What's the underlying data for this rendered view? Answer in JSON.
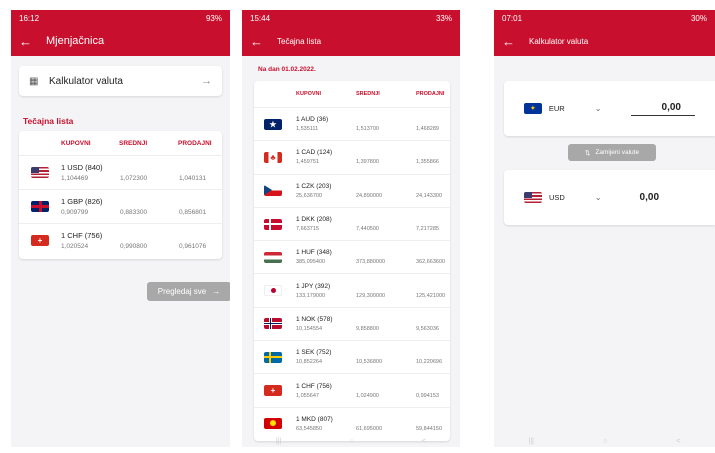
{
  "screen1": {
    "status": {
      "time": "16:12",
      "battery": "93%"
    },
    "title": "Mjenjačnica",
    "converter_label": "Kalkulator valuta",
    "rates_title": "Tečajna lista",
    "columns": {
      "buy": "KUPOVNI",
      "mid": "SREDNJI",
      "sell": "PRODAJNI"
    },
    "rates": [
      {
        "flag": "us",
        "name": "1 USD (840)",
        "buy": "1,104469",
        "mid": "1,072300",
        "sell": "1,040131"
      },
      {
        "flag": "gb",
        "name": "1 GBP (826)",
        "buy": "0,909799",
        "mid": "0,883300",
        "sell": "0,856801"
      },
      {
        "flag": "ch",
        "name": "1 CHF (756)",
        "buy": "1,020524",
        "mid": "0,990800",
        "sell": "0,961076"
      }
    ],
    "view_all": "Pregledaj sve"
  },
  "screen2": {
    "status": {
      "time": "15:44",
      "battery": "33%"
    },
    "title": "Tečajna lista",
    "date_line": "Na dan 01.02.2022.",
    "columns": {
      "buy": "KUPOVNI",
      "mid": "SREDNJI",
      "sell": "PRODAJNI"
    },
    "rates": [
      {
        "flag": "au",
        "name": "1 AUD (36)",
        "buy": "1,535111",
        "mid": "1,513700",
        "sell": "1,468289"
      },
      {
        "flag": "ca",
        "name": "1 CAD (124)",
        "buy": "1,459751",
        "mid": "1,397800",
        "sell": "1,355866"
      },
      {
        "flag": "cz",
        "name": "1 CZK (203)",
        "buy": "25,636700",
        "mid": "24,890000",
        "sell": "24,143300"
      },
      {
        "flag": "dk",
        "name": "1 DKK (208)",
        "buy": "7,663715",
        "mid": "7,440500",
        "sell": "7,217285"
      },
      {
        "flag": "hu",
        "name": "1 HUF (348)",
        "buy": "385,095400",
        "mid": "373,880000",
        "sell": "362,663600"
      },
      {
        "flag": "jp",
        "name": "1 JPY (392)",
        "buy": "133,179000",
        "mid": "129,300000",
        "sell": "125,421000"
      },
      {
        "flag": "no",
        "name": "1 NOK (578)",
        "buy": "10,154554",
        "mid": "9,858800",
        "sell": "9,563036"
      },
      {
        "flag": "se",
        "name": "1 SEK (752)",
        "buy": "10,852264",
        "mid": "10,536800",
        "sell": "10,220696"
      },
      {
        "flag": "ch",
        "name": "1 CHF (756)",
        "buy": "1,055647",
        "mid": "1,024900",
        "sell": "0,994153"
      },
      {
        "flag": "mk",
        "name": "1 MKD (807)",
        "buy": "63,545850",
        "mid": "61,695000",
        "sell": "59,844150"
      }
    ]
  },
  "screen3": {
    "status": {
      "time": "07:01",
      "battery": "30%"
    },
    "title": "Kalkulator valuta",
    "from": {
      "flag": "eu",
      "code": "EUR",
      "amount": "0,00"
    },
    "swap_label": "Zamijeni valute",
    "to": {
      "flag": "us",
      "code": "USD",
      "amount": "0,00"
    }
  },
  "colors": {
    "brand": "#c8102e",
    "button_grey": "#a8a8a8"
  }
}
